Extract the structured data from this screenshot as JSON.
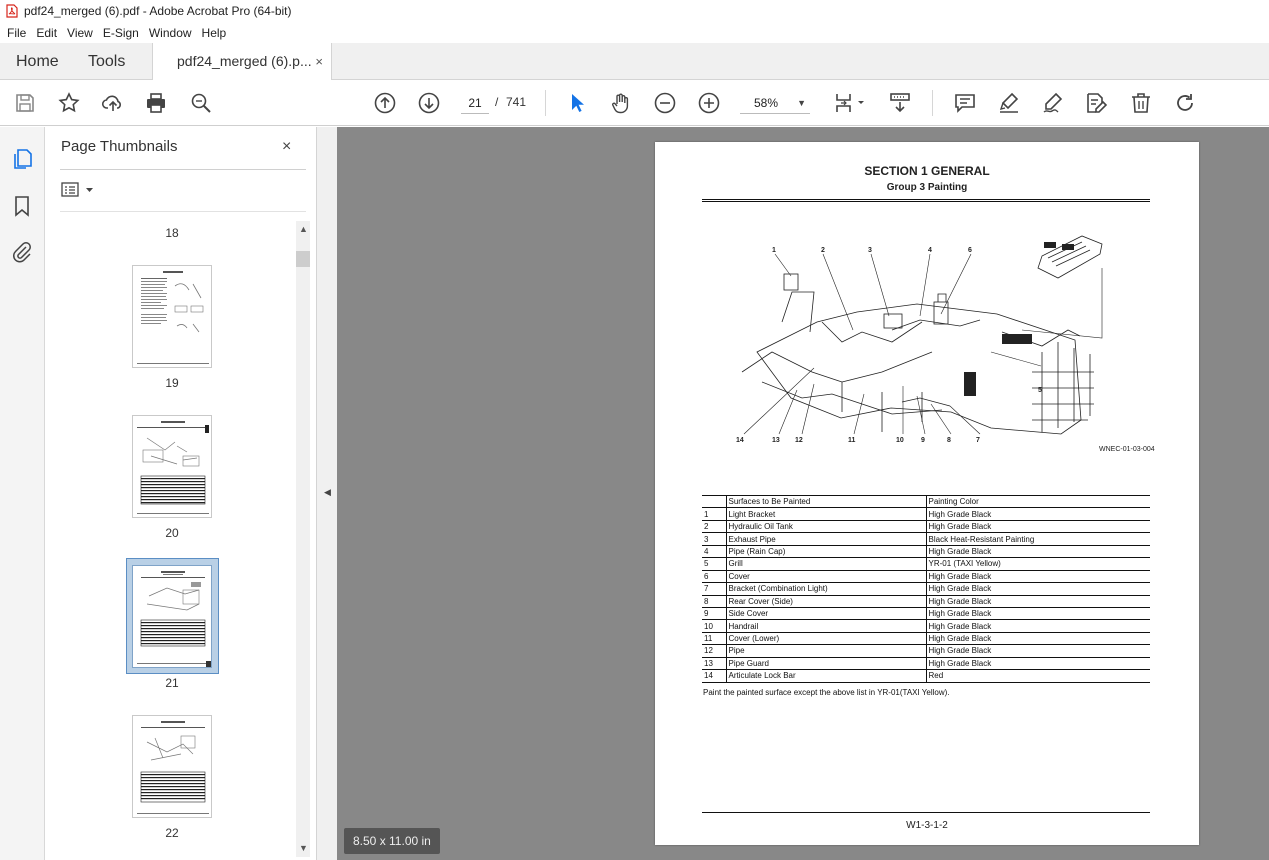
{
  "window": {
    "title": "pdf24_merged (6).pdf - Adobe Acrobat Pro (64-bit)"
  },
  "menu": [
    "File",
    "Edit",
    "View",
    "E-Sign",
    "Window",
    "Help"
  ],
  "tabs": {
    "home": "Home",
    "tools": "Tools",
    "document": "pdf24_merged (6).p...",
    "close": "×"
  },
  "toolbar": {
    "current_page": "21",
    "page_separator": "/",
    "total_pages": "741",
    "zoom": "58%",
    "icons": [
      "save-icon",
      "bookmark-star-icon",
      "share-upload-icon",
      "print-icon",
      "find-zoom-icon",
      "prev-page-icon",
      "next-page-icon",
      "select-cursor-icon",
      "hand-icon",
      "zoom-out-icon",
      "zoom-in-icon",
      "zoom-dropdown-icon",
      "page-fit-icon",
      "scroll-mode-icon",
      "comment-icon",
      "highlight-icon",
      "sign-icon",
      "edit-pdf-icon",
      "delete-icon",
      "redo-icon"
    ]
  },
  "sidebar": {
    "panel_title": "Page Thumbnails",
    "close": "×",
    "rail_icons": [
      "page-thumbnails-icon",
      "bookmarks-icon",
      "attachments-icon"
    ],
    "thumbnails": [
      {
        "label": "18"
      },
      {
        "label": "19"
      },
      {
        "label": "20"
      },
      {
        "label": "21",
        "selected": true
      },
      {
        "label": "22"
      }
    ]
  },
  "document": {
    "page_size": "8.50 x 11.00 in",
    "section_title": "SECTION 1 GENERAL",
    "group_title": "Group 3 Painting",
    "diagram_code": "WNEC-01-03-004",
    "callouts": [
      "1",
      "2",
      "3",
      "4",
      "6",
      "5",
      "14",
      "13",
      "12",
      "11",
      "10",
      "9",
      "8",
      "7"
    ],
    "table": {
      "header": [
        "",
        "Surfaces to Be Painted",
        "Painting Color"
      ],
      "rows": [
        [
          "1",
          "Light Bracket",
          "High Grade Black"
        ],
        [
          "2",
          "Hydraulic Oil Tank",
          "High Grade Black"
        ],
        [
          "3",
          "Exhaust Pipe",
          "Black Heat-Resistant Painting"
        ],
        [
          "4",
          "Pipe (Rain Cap)",
          "High Grade Black"
        ],
        [
          "5",
          "Grill",
          "YR-01 (TAXI Yellow)"
        ],
        [
          "6",
          "Cover",
          "High Grade Black"
        ],
        [
          "7",
          "Bracket (Combination Light)",
          "High Grade Black"
        ],
        [
          "8",
          "Rear Cover (Side)",
          "High Grade Black"
        ],
        [
          "9",
          "Side Cover",
          "High Grade Black"
        ],
        [
          "10",
          "Handrail",
          "High Grade Black"
        ],
        [
          "11",
          "Cover (Lower)",
          "High Grade Black"
        ],
        [
          "12",
          "Pipe",
          "High Grade Black"
        ],
        [
          "13",
          "Pipe Guard",
          "High Grade Black"
        ],
        [
          "14",
          "Articulate Lock Bar",
          "Red"
        ]
      ]
    },
    "note": "Paint the painted surface except the above list in YR-01(TAXI Yellow).",
    "footer": "W1-3-1-2"
  },
  "colors": {
    "acrobat_red": "#d7261c",
    "select_blue": "#1473e6",
    "doc_background": "#888888"
  }
}
